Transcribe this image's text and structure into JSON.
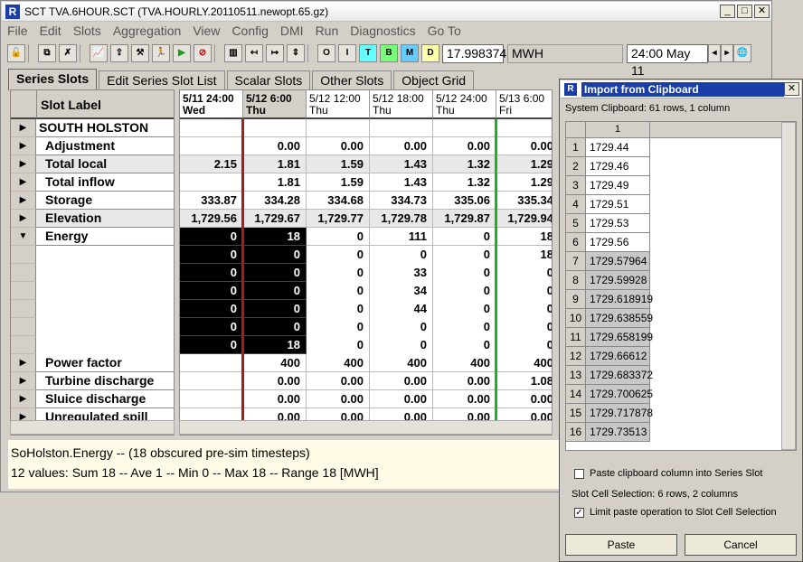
{
  "window": {
    "title": "SCT TVA.6HOUR.SCT (TVA.HOURLY.20110511.newopt.65.gz)"
  },
  "menu": [
    "File",
    "Edit",
    "Slots",
    "Aggregation",
    "View",
    "Config",
    "DMI",
    "Run",
    "Diagnostics",
    "Go To"
  ],
  "toolbar": {
    "value": "17.998374",
    "unit": "MWH",
    "datetime": "24:00 May 11"
  },
  "tabs": [
    "Series Slots",
    "Edit Series Slot List",
    "Scalar Slots",
    "Other Slots",
    "Object Grid"
  ],
  "grid": {
    "label_header": "Slot Label",
    "columns": [
      {
        "date": "5/11 24:00",
        "day": "Wed"
      },
      {
        "date": "5/12 6:00",
        "day": "Thu"
      },
      {
        "date": "5/12 12:00",
        "day": "Thu"
      },
      {
        "date": "5/12 18:00",
        "day": "Thu"
      },
      {
        "date": "5/12 24:00",
        "day": "Thu"
      },
      {
        "date": "5/13 6:00",
        "day": "Fri"
      }
    ],
    "rows": [
      {
        "label": "SOUTH HOLSTON",
        "arrow": "▶",
        "values": [
          "",
          "",
          "",
          "",
          "",
          ""
        ]
      },
      {
        "label": "Adjustment",
        "arrow": "▶",
        "values": [
          "",
          "0.00",
          "0.00",
          "0.00",
          "0.00",
          "0.00"
        ]
      },
      {
        "label": "Total local",
        "arrow": "▶",
        "values": [
          "2.15",
          "1.81",
          "1.59",
          "1.43",
          "1.32",
          "1.29"
        ]
      },
      {
        "label": "Total inflow",
        "arrow": "▶",
        "values": [
          "",
          "1.81",
          "1.59",
          "1.43",
          "1.32",
          "1.29"
        ]
      },
      {
        "label": "Storage",
        "arrow": "▶",
        "values": [
          "333.87",
          "334.28",
          "334.68",
          "334.73",
          "335.06",
          "335.34"
        ]
      },
      {
        "label": "Elevation",
        "arrow": "▶",
        "values": [
          "1,729.56",
          "1,729.67",
          "1,729.77",
          "1,729.78",
          "1,729.87",
          "1,729.94"
        ]
      },
      {
        "label": "Energy",
        "arrow": "▼",
        "values": [
          "0",
          "18",
          "0",
          "111",
          "0",
          "18"
        ]
      },
      {
        "label": "",
        "arrow": "",
        "values": [
          "0",
          "0",
          "0",
          "0",
          "0",
          "18"
        ]
      },
      {
        "label": "",
        "arrow": "",
        "values": [
          "0",
          "0",
          "0",
          "33",
          "0",
          "0"
        ]
      },
      {
        "label": "",
        "arrow": "",
        "values": [
          "0",
          "0",
          "0",
          "34",
          "0",
          "0"
        ]
      },
      {
        "label": "",
        "arrow": "",
        "values": [
          "0",
          "0",
          "0",
          "44",
          "0",
          "0"
        ]
      },
      {
        "label": "",
        "arrow": "",
        "values": [
          "0",
          "0",
          "0",
          "0",
          "0",
          "0"
        ]
      },
      {
        "label": "",
        "arrow": "",
        "values": [
          "0",
          "18",
          "0",
          "0",
          "0",
          "0"
        ]
      },
      {
        "label": "Power  factor",
        "arrow": "▶",
        "values": [
          "",
          "400",
          "400",
          "400",
          "400",
          "400"
        ]
      },
      {
        "label": "Turbine discharge",
        "arrow": "▶",
        "values": [
          "",
          "0.00",
          "0.00",
          "0.00",
          "0.00",
          "1.08"
        ]
      },
      {
        "label": "Sluice discharge",
        "arrow": "▶",
        "values": [
          "",
          "0.00",
          "0.00",
          "0.00",
          "0.00",
          "0.00"
        ]
      },
      {
        "label": "Unregulated spill",
        "arrow": "▶",
        "values": [
          "",
          "0.00",
          "0.00",
          "0.00",
          "0.00",
          "0.00"
        ]
      }
    ]
  },
  "status": {
    "line1": "SoHolston.Energy -- (18 obscured pre-sim timesteps)",
    "line2": "12 values:  Sum 18 -- Ave 1 -- Min 0 -- Max 18 -- Range 18 [MWH]"
  },
  "dialog": {
    "title": "Import from Clipboard",
    "info": "System Clipboard:  61 rows, 1 column",
    "col_header": "1",
    "rows": [
      {
        "n": "1",
        "v": "1729.44"
      },
      {
        "n": "2",
        "v": "1729.46"
      },
      {
        "n": "3",
        "v": "1729.49"
      },
      {
        "n": "4",
        "v": "1729.51"
      },
      {
        "n": "5",
        "v": "1729.53"
      },
      {
        "n": "6",
        "v": "1729.56"
      },
      {
        "n": "7",
        "v": "1729.57964"
      },
      {
        "n": "8",
        "v": "1729.59928"
      },
      {
        "n": "9",
        "v": "1729.618919"
      },
      {
        "n": "10",
        "v": "1729.638559"
      },
      {
        "n": "11",
        "v": "1729.658199"
      },
      {
        "n": "12",
        "v": "1729.66612"
      },
      {
        "n": "13",
        "v": "1729.683372"
      },
      {
        "n": "14",
        "v": "1729.700625"
      },
      {
        "n": "15",
        "v": "1729.717878"
      },
      {
        "n": "16",
        "v": "1729.73513"
      }
    ],
    "paste_into_label": "Paste clipboard column into Series Slot",
    "selection_info": "Slot Cell Selection:  6 rows, 2 columns",
    "limit_label": "Limit paste operation to Slot Cell Selection",
    "paste_button": "Paste",
    "cancel_button": "Cancel"
  }
}
